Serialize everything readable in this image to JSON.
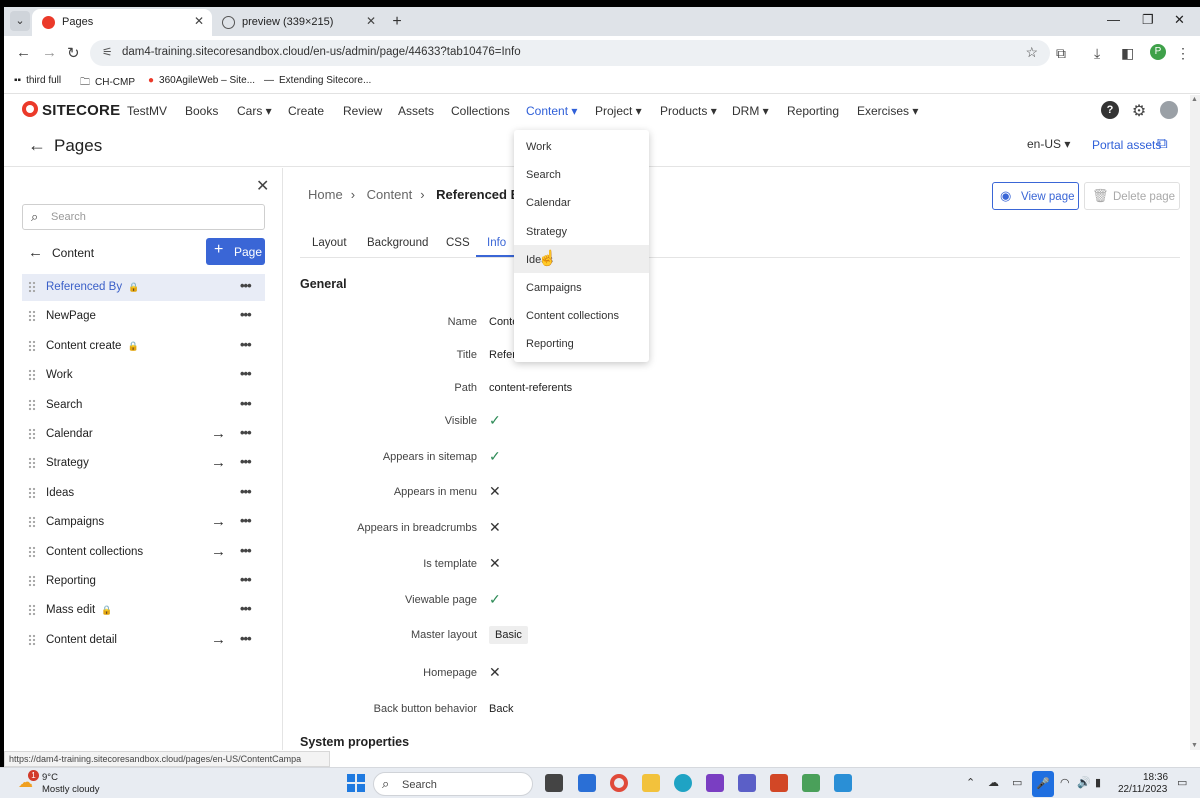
{
  "browser": {
    "tabs": [
      {
        "title": "Pages",
        "active": true
      },
      {
        "title": "preview (339×215)",
        "active": false
      }
    ],
    "url": "dam4-training.sitecoresandbox.cloud/en-us/admin/page/44633?tab10476=Info",
    "profile_initial": "P",
    "bookmarks": [
      "third full",
      "CH-CMP",
      "360AgileWeb – Site...",
      "Extending Sitecore..."
    ]
  },
  "app": {
    "brand": "SITECORE",
    "nav": [
      "TestMV",
      "Books",
      "Cars ▾",
      "Create",
      "Review",
      "Assets",
      "Collections",
      "Content ▾",
      "Project ▾",
      "Products ▾",
      "DRM ▾",
      "Reporting",
      "Exercises ▾"
    ],
    "active_nav": "Content"
  },
  "page_header": {
    "title": "Pages",
    "language": "en-US ▾",
    "portal_assets": "Portal assets"
  },
  "left_panel": {
    "search_placeholder": "Search",
    "section": "Content",
    "add_button": "Page",
    "items": [
      {
        "name": "Referenced By",
        "locked": true,
        "arrow": false,
        "selected": true
      },
      {
        "name": "NewPage",
        "locked": false,
        "arrow": false
      },
      {
        "name": "Content create",
        "locked": true,
        "arrow": false
      },
      {
        "name": "Work",
        "locked": false,
        "arrow": false
      },
      {
        "name": "Search",
        "locked": false,
        "arrow": false
      },
      {
        "name": "Calendar",
        "locked": false,
        "arrow": true
      },
      {
        "name": "Strategy",
        "locked": false,
        "arrow": true
      },
      {
        "name": "Ideas",
        "locked": false,
        "arrow": false
      },
      {
        "name": "Campaigns",
        "locked": false,
        "arrow": true
      },
      {
        "name": "Content collections",
        "locked": false,
        "arrow": true
      },
      {
        "name": "Reporting",
        "locked": false,
        "arrow": false
      },
      {
        "name": "Mass edit",
        "locked": true,
        "arrow": false
      },
      {
        "name": "Content detail",
        "locked": false,
        "arrow": true
      }
    ]
  },
  "main": {
    "breadcrumb": [
      "Home",
      "Content",
      "Referenced By"
    ],
    "view_page": "View page",
    "delete_page": "Delete page",
    "tabs": [
      "Layout",
      "Background",
      "CSS",
      "Info"
    ],
    "active_tab": "Info",
    "general_title": "General",
    "fields": [
      {
        "label": "Name",
        "value": "Conte",
        "type": "text"
      },
      {
        "label": "Title",
        "value": "Refere",
        "type": "text"
      },
      {
        "label": "Path",
        "value": "content-referents",
        "type": "text"
      },
      {
        "label": "Visible",
        "value": "true",
        "type": "bool"
      },
      {
        "label": "Appears in sitemap",
        "value": "true",
        "type": "bool"
      },
      {
        "label": "Appears in menu",
        "value": "false",
        "type": "bool"
      },
      {
        "label": "Appears in breadcrumbs",
        "value": "false",
        "type": "bool"
      },
      {
        "label": "Is template",
        "value": "false",
        "type": "bool"
      },
      {
        "label": "Viewable page",
        "value": "true",
        "type": "bool"
      },
      {
        "label": "Master layout",
        "value": "Basic",
        "type": "chip"
      },
      {
        "label": "Homepage",
        "value": "false",
        "type": "bool"
      },
      {
        "label": "Back button behavior",
        "value": "Back",
        "type": "text"
      }
    ],
    "system_title": "System properties"
  },
  "content_menu": {
    "items": [
      "Work",
      "Search",
      "Calendar",
      "Strategy",
      "Ideas",
      "Campaigns",
      "Content collections",
      "Reporting"
    ],
    "hovered": "Ideas"
  },
  "status_url": "https://dam4-training.sitecoresandbox.cloud/pages/en-US/ContentCampa",
  "taskbar": {
    "weather_badge": "1",
    "temperature": "9°C",
    "condition": "Mostly cloudy",
    "search_label": "Search",
    "time": "18:36",
    "date": "22/11/2023"
  }
}
